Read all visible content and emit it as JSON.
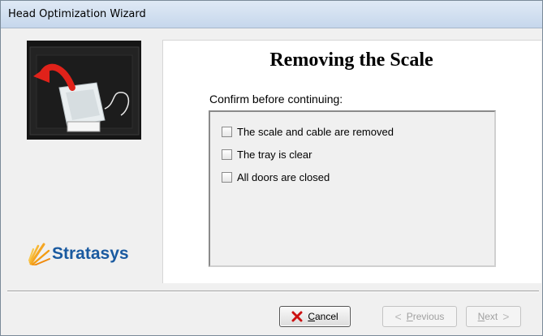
{
  "window": {
    "title": "Head Optimization Wizard"
  },
  "sidebar": {
    "logo_text": "Stratasys"
  },
  "main": {
    "heading": "Removing the Scale",
    "prompt": "Confirm before continuing:",
    "checklist": [
      {
        "label": "The scale and cable are removed",
        "checked": false
      },
      {
        "label": "The tray is clear",
        "checked": false
      },
      {
        "label": "All doors are closed",
        "checked": false
      }
    ]
  },
  "buttons": {
    "cancel": {
      "accel": "C",
      "rest": "ancel",
      "enabled": true
    },
    "previous": {
      "accel": "P",
      "rest": "revious",
      "enabled": false
    },
    "next": {
      "accel": "N",
      "rest": "ext",
      "enabled": false
    }
  },
  "colors": {
    "brand": "#1a5aa0",
    "cancel_icon": "#cc1111",
    "arrow": "#e0221a"
  }
}
